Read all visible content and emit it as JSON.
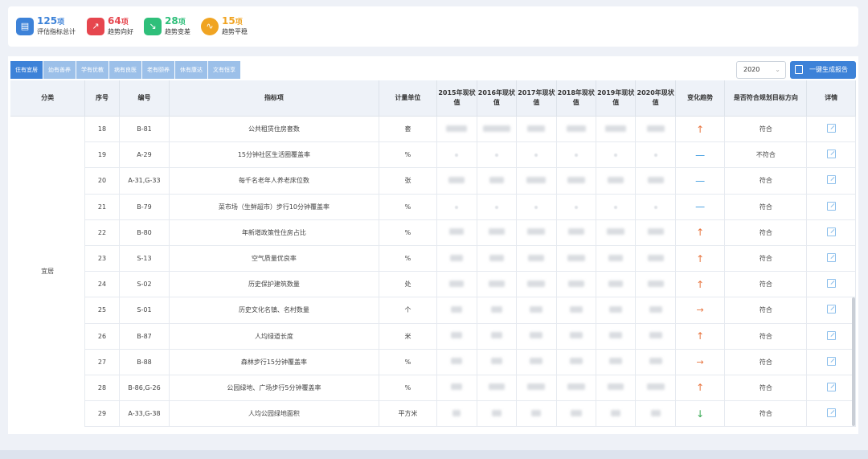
{
  "stats": [
    {
      "num": "125",
      "unit": "项",
      "label": "评估指标总计",
      "color": "#3d82d8",
      "icon": "document-icon"
    },
    {
      "num": "64",
      "unit": "项",
      "label": "趋势向好",
      "color": "#e6464e",
      "icon": "trend-up-icon"
    },
    {
      "num": "28",
      "unit": "项",
      "label": "趋势变差",
      "color": "#2fbf7a",
      "icon": "trend-down-icon"
    },
    {
      "num": "15",
      "unit": "项",
      "label": "趋势平稳",
      "color": "#f0a422",
      "icon": "trend-flat-icon"
    }
  ],
  "tabs": [
    "住有宜居",
    "幼有善养",
    "学有优教",
    "病有良医",
    "老有颐养",
    "休有康达",
    "文有恒享"
  ],
  "year_select": "2020",
  "generate_button": "一键生成报告",
  "headers": {
    "category": "分类",
    "seq": "序号",
    "code": "编号",
    "indicator": "指标项",
    "unit": "计量单位",
    "y2015": "2015年现状值",
    "y2016": "2016年现状值",
    "y2017": "2017年现状值",
    "y2018": "2018年现状值",
    "y2019": "2019年现状值",
    "y2020": "2020年现状值",
    "trend": "变化趋势",
    "target": "是否符合规划目标方向",
    "detail": "详情"
  },
  "category": "宜居",
  "rows": [
    {
      "seq": "18",
      "code": "B-81",
      "name": "公共租赁住房套数",
      "unit": "套",
      "trend": "up",
      "target": "符合"
    },
    {
      "seq": "19",
      "code": "A-29",
      "name": "15分钟社区生活圈覆盖率",
      "unit": "%",
      "trend": "flat",
      "target": "不符合"
    },
    {
      "seq": "20",
      "code": "A-31,G-33",
      "name": "每千名老年人养老床位数",
      "unit": "张",
      "trend": "flat",
      "target": "符合"
    },
    {
      "seq": "21",
      "code": "B-79",
      "name": "菜市场（生鲜超市）步行10分钟覆盖率",
      "unit": "%",
      "trend": "flat",
      "target": "符合"
    },
    {
      "seq": "22",
      "code": "B-80",
      "name": "年新增政策性住房占比",
      "unit": "%",
      "trend": "up",
      "target": "符合"
    },
    {
      "seq": "23",
      "code": "S-13",
      "name": "空气质量优良率",
      "unit": "%",
      "trend": "up",
      "target": "符合"
    },
    {
      "seq": "24",
      "code": "S-02",
      "name": "历史保护建筑数量",
      "unit": "处",
      "trend": "up",
      "target": "符合"
    },
    {
      "seq": "25",
      "code": "S-01",
      "name": "历史文化名镇、名村数量",
      "unit": "个",
      "trend": "right",
      "target": "符合"
    },
    {
      "seq": "26",
      "code": "B-87",
      "name": "人均绿道长度",
      "unit": "米",
      "trend": "up",
      "target": "符合"
    },
    {
      "seq": "27",
      "code": "B-88",
      "name": "森林步行15分钟覆盖率",
      "unit": "%",
      "trend": "right",
      "target": "符合"
    },
    {
      "seq": "28",
      "code": "B-86,G-26",
      "name": "公园绿地、广场步行5分钟覆盖率",
      "unit": "%",
      "trend": "up",
      "target": "符合"
    },
    {
      "seq": "29",
      "code": "A-33,G-38",
      "name": "人均公园绿地面积",
      "unit": "平方米",
      "trend": "down",
      "target": "符合"
    }
  ],
  "trend_glyphs": {
    "up": "↑",
    "flat": "—",
    "right": "→",
    "down": "↓"
  }
}
